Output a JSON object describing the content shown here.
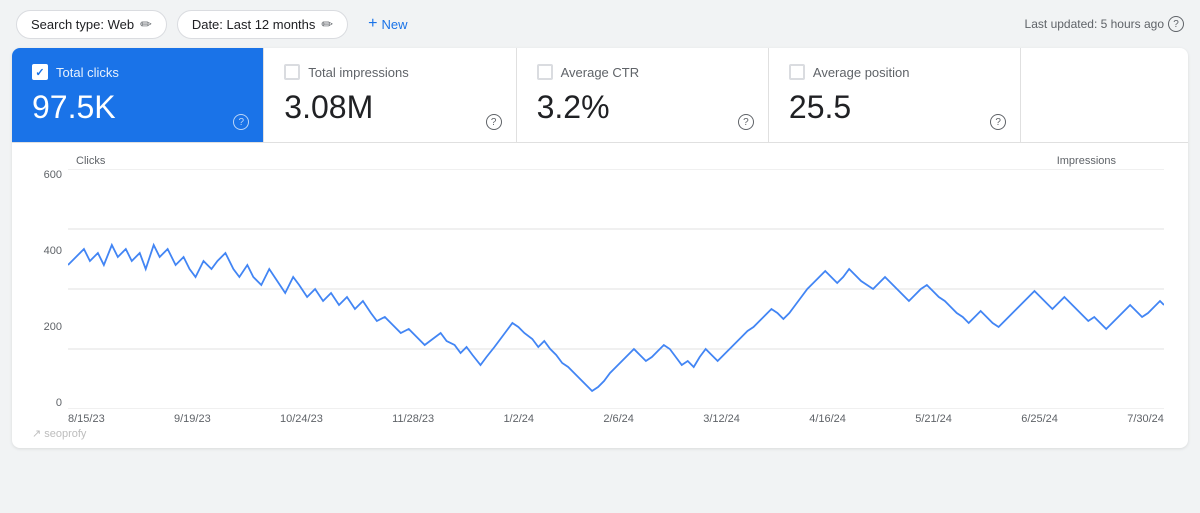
{
  "topbar": {
    "search_type_label": "Search type: Web",
    "date_label": "Date: Last 12 months",
    "new_label": "New",
    "last_updated": "Last updated: 5 hours ago"
  },
  "metrics": [
    {
      "id": "total_clicks",
      "label": "Total clicks",
      "value": "97.5K",
      "active": true,
      "checked": true
    },
    {
      "id": "total_impressions",
      "label": "Total impressions",
      "value": "3.08M",
      "active": false,
      "checked": false
    },
    {
      "id": "average_ctr",
      "label": "Average CTR",
      "value": "3.2%",
      "active": false,
      "checked": false
    },
    {
      "id": "average_position",
      "label": "Average position",
      "value": "25.5",
      "active": false,
      "checked": false
    }
  ],
  "chart": {
    "y_axis_left_label": "Clicks",
    "y_axis_right_label": "Impressions",
    "y_ticks": [
      "600",
      "400",
      "200",
      "0"
    ],
    "x_ticks": [
      "8/15/23",
      "9/19/23",
      "10/24/23",
      "11/28/23",
      "1/2/24",
      "2/6/24",
      "3/12/24",
      "4/16/24",
      "5/21/24",
      "6/25/24",
      "7/30/24"
    ],
    "line_color": "#4285f4"
  },
  "watermark": {
    "text": "seoprofy",
    "icon": "↗"
  }
}
